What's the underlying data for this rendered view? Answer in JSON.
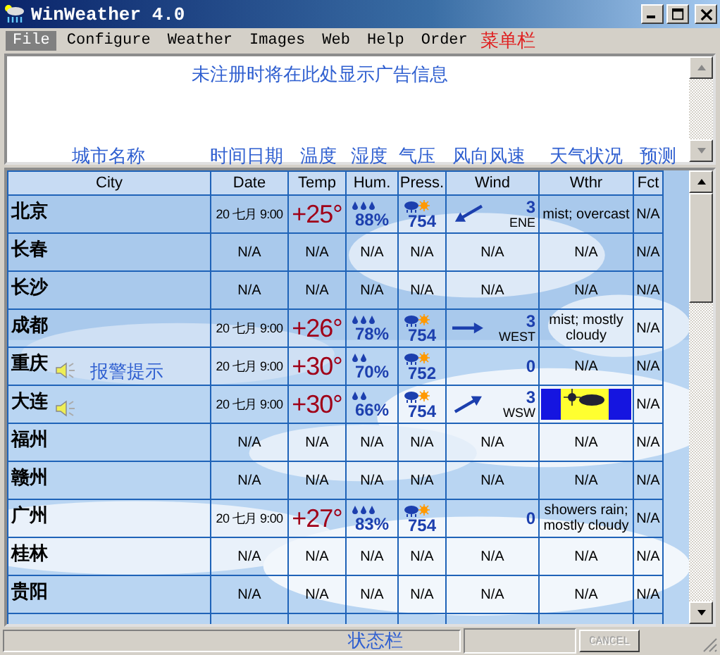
{
  "window": {
    "title": "WinWeather 4.0"
  },
  "menu": [
    {
      "label": "File",
      "selected": true
    },
    {
      "label": "Configure",
      "selected": false
    },
    {
      "label": "Weather",
      "selected": false
    },
    {
      "label": "Images",
      "selected": false
    },
    {
      "label": "Web",
      "selected": false
    },
    {
      "label": "Help",
      "selected": false
    },
    {
      "label": "Order",
      "selected": false
    }
  ],
  "notes": {
    "menu": "菜单栏",
    "ad": "未注册时将在此处显示广告信息",
    "alarm": "报警提示",
    "status": "状态栏",
    "columns": [
      "城市名称",
      "时间日期",
      "温度",
      "湿度",
      "气压",
      "风向风速",
      "天气状况",
      "预测"
    ]
  },
  "table": {
    "columns": [
      "City",
      "Date",
      "Temp",
      "Hum.",
      "Press.",
      "Wind",
      "Wthr",
      "Fct"
    ],
    "rows": [
      {
        "city": "北京",
        "alarm": false,
        "date": "20 七月 9:00",
        "temp": "+25°",
        "humidity_icon": {
          "kind": "three"
        },
        "humidity": "88%",
        "pressure": "754",
        "wind_speed": "3",
        "wind_dir": "ENE",
        "wind_icon": {
          "kind": "southwest"
        },
        "weather": {
          "kind": "text",
          "text": "mist; overcast"
        },
        "forecast": "N/A"
      },
      {
        "city": "长春",
        "alarm": false,
        "date": "N/A",
        "temp": "N/A",
        "humidity": "N/A",
        "pressure": "N/A",
        "wind_speed": "N/A",
        "weather": {
          "kind": "text",
          "text": "N/A"
        },
        "forecast": "N/A"
      },
      {
        "city": "长沙",
        "alarm": false,
        "date": "N/A",
        "temp": "N/A",
        "humidity": "N/A",
        "pressure": "N/A",
        "wind_speed": "N/A",
        "weather": {
          "kind": "text",
          "text": "N/A"
        },
        "forecast": "N/A"
      },
      {
        "city": "成都",
        "alarm": false,
        "date": "20 七月 9:00",
        "temp": "+26°",
        "humidity_icon": {
          "kind": "three"
        },
        "humidity": "78%",
        "pressure": "754",
        "wind_speed": "3",
        "wind_dir": "WEST",
        "wind_icon": {
          "kind": "east"
        },
        "weather": {
          "kind": "text",
          "text": "mist; mostly cloudy"
        },
        "forecast": "N/A"
      },
      {
        "city": "重庆",
        "alarm": true,
        "date": "20 七月 9:00",
        "temp": "+30°",
        "humidity_icon": {
          "kind": "two"
        },
        "humidity": "70%",
        "pressure": "752",
        "wind_speed": "0",
        "weather": {
          "kind": "text",
          "text": "N/A"
        },
        "forecast": "N/A"
      },
      {
        "city": "大连",
        "alarm": true,
        "date": "20 七月 9:00",
        "temp": "+30°",
        "humidity_icon": {
          "kind": "two"
        },
        "humidity": "66%",
        "pressure": "754",
        "wind_speed": "3",
        "wind_dir": "WSW",
        "wind_icon": {
          "kind": "northeast"
        },
        "weather": {
          "kind": "icon"
        },
        "forecast": "N/A"
      },
      {
        "city": "福州",
        "alarm": false,
        "date": "N/A",
        "temp": "N/A",
        "humidity": "N/A",
        "pressure": "N/A",
        "wind_speed": "N/A",
        "weather": {
          "kind": "text",
          "text": "N/A"
        },
        "forecast": "N/A"
      },
      {
        "city": "赣州",
        "alarm": false,
        "date": "N/A",
        "temp": "N/A",
        "humidity": "N/A",
        "pressure": "N/A",
        "wind_speed": "N/A",
        "weather": {
          "kind": "text",
          "text": "N/A"
        },
        "forecast": "N/A"
      },
      {
        "city": "广州",
        "alarm": false,
        "date": "20 七月 9:00",
        "temp": "+27°",
        "humidity_icon": {
          "kind": "three"
        },
        "humidity": "83%",
        "pressure": "754",
        "wind_speed": "0",
        "weather": {
          "kind": "text",
          "text": "showers rain; mostly cloudy"
        },
        "forecast": "N/A"
      },
      {
        "city": "桂林",
        "alarm": false,
        "date": "N/A",
        "temp": "N/A",
        "humidity": "N/A",
        "pressure": "N/A",
        "wind_speed": "N/A",
        "weather": {
          "kind": "text",
          "text": "N/A"
        },
        "forecast": "N/A"
      },
      {
        "city": "贵阳",
        "alarm": false,
        "date": "N/A",
        "temp": "N/A",
        "humidity": "N/A",
        "pressure": "N/A",
        "wind_speed": "N/A",
        "weather": {
          "kind": "text",
          "text": "N/A"
        },
        "forecast": "N/A"
      }
    ]
  },
  "status_bar": {
    "button": {
      "label": "CANCEL",
      "disabled": true
    }
  }
}
